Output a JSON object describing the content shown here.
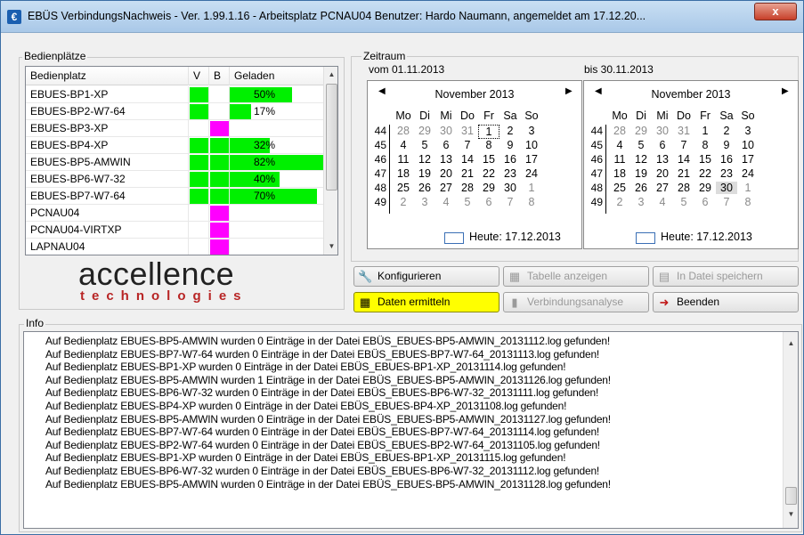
{
  "window": {
    "title": "EBÜS VerbindungsNachweis - Ver. 1.99.1.16 - Arbeitsplatz PCNAU04   Benutzer: Hardo Naumann, angemeldet am 17.12.20...",
    "close_label": "x"
  },
  "bedienplaetze": {
    "group_title": "Bedienplätze",
    "columns": [
      "Bedienplatz",
      "V",
      "B",
      "Geladen"
    ],
    "rows": [
      {
        "name": "EBUES-BP1-XP",
        "v_color": "#00f000",
        "b_color": "#ffffff",
        "geladen": 0.5,
        "geladen_text": "50%"
      },
      {
        "name": "EBUES-BP2-W7-64",
        "v_color": "#00f000",
        "b_color": "#ffffff",
        "geladen": 0.17,
        "geladen_text": "17%"
      },
      {
        "name": "EBUES-BP3-XP",
        "v_color": "#ffffff",
        "b_color": "#ff00ff",
        "geladen": 0,
        "geladen_text": ""
      },
      {
        "name": "EBUES-BP4-XP",
        "v_color": "#00f000",
        "b_color": "#00f000",
        "geladen": 0.32,
        "geladen_text": "32%"
      },
      {
        "name": "EBUES-BP5-AMWIN",
        "v_color": "#00f000",
        "b_color": "#00f000",
        "geladen": 0.82,
        "geladen_text": "82%"
      },
      {
        "name": "EBUES-BP6-W7-32",
        "v_color": "#00f000",
        "b_color": "#00f000",
        "geladen": 0.4,
        "geladen_text": "40%"
      },
      {
        "name": "EBUES-BP7-W7-64",
        "v_color": "#00f000",
        "b_color": "#00f000",
        "geladen": 0.7,
        "geladen_text": "70%"
      },
      {
        "name": "PCNAU04",
        "v_color": "#ffffff",
        "b_color": "#ff00ff",
        "geladen": 0,
        "geladen_text": ""
      },
      {
        "name": "PCNAU04-VIRTXP",
        "v_color": "#ffffff",
        "b_color": "#ff00ff",
        "geladen": 0,
        "geladen_text": ""
      },
      {
        "name": "LAPNAU04",
        "v_color": "#ffffff",
        "b_color": "#ff00ff",
        "geladen": 0,
        "geladen_text": ""
      }
    ]
  },
  "logo": {
    "main": "accellence",
    "sub": "technologies"
  },
  "zeitraum": {
    "group_title": "Zeitraum",
    "von_label": "vom 01.11.2013",
    "bis_label": "bis 30.11.2013",
    "calendars": [
      {
        "month": "November 2013",
        "dow": [
          "Mo",
          "Di",
          "Mi",
          "Do",
          "Fr",
          "Sa",
          "So"
        ],
        "weeks": [
          {
            "wk": "44",
            "days": [
              "28",
              "29",
              "30",
              "31",
              "1",
              "2",
              "3"
            ]
          },
          {
            "wk": "45",
            "days": [
              "4",
              "5",
              "6",
              "7",
              "8",
              "9",
              "10"
            ]
          },
          {
            "wk": "46",
            "days": [
              "11",
              "12",
              "13",
              "14",
              "15",
              "16",
              "17"
            ]
          },
          {
            "wk": "47",
            "days": [
              "18",
              "19",
              "20",
              "21",
              "22",
              "23",
              "24"
            ]
          },
          {
            "wk": "48",
            "days": [
              "25",
              "26",
              "27",
              "28",
              "29",
              "30",
              "1"
            ]
          },
          {
            "wk": "49",
            "days": [
              "2",
              "3",
              "4",
              "5",
              "6",
              "7",
              "8"
            ]
          }
        ],
        "selected_day": "1",
        "today_label": "Heute: 17.12.2013"
      },
      {
        "month": "November 2013",
        "dow": [
          "Mo",
          "Di",
          "Mi",
          "Do",
          "Fr",
          "Sa",
          "So"
        ],
        "weeks": [
          {
            "wk": "44",
            "days": [
              "28",
              "29",
              "30",
              "31",
              "1",
              "2",
              "3"
            ]
          },
          {
            "wk": "45",
            "days": [
              "4",
              "5",
              "6",
              "7",
              "8",
              "9",
              "10"
            ]
          },
          {
            "wk": "46",
            "days": [
              "11",
              "12",
              "13",
              "14",
              "15",
              "16",
              "17"
            ]
          },
          {
            "wk": "47",
            "days": [
              "18",
              "19",
              "20",
              "21",
              "22",
              "23",
              "24"
            ]
          },
          {
            "wk": "48",
            "days": [
              "25",
              "26",
              "27",
              "28",
              "29",
              "30",
              "1"
            ]
          },
          {
            "wk": "49",
            "days": [
              "2",
              "3",
              "4",
              "5",
              "6",
              "7",
              "8"
            ]
          }
        ],
        "selected_day": "30",
        "today_label": "Heute: 17.12.2013"
      }
    ]
  },
  "buttons": {
    "konfigurieren": "Konfigurieren",
    "tabelle": "Tabelle anzeigen",
    "speichern": "In Datei speichern",
    "daten": "Daten ermitteln",
    "analyse": "Verbindungsanalyse",
    "beenden": "Beenden"
  },
  "info": {
    "group_title": "Info",
    "lines": [
      "Auf Bedienplatz EBUES-BP5-AMWIN wurden 0 Einträge in der Datei EBÜS_EBUES-BP5-AMWIN_20131112.log gefunden!",
      "Auf Bedienplatz EBUES-BP7-W7-64 wurden 0 Einträge in der Datei EBÜS_EBUES-BP7-W7-64_20131113.log gefunden!",
      "Auf Bedienplatz EBUES-BP1-XP wurden 0 Einträge in der Datei EBÜS_EBUES-BP1-XP_20131114.log gefunden!",
      "Auf Bedienplatz EBUES-BP5-AMWIN wurden 1 Einträge in der Datei EBÜS_EBUES-BP5-AMWIN_20131126.log gefunden!",
      "Auf Bedienplatz EBUES-BP6-W7-32 wurden 0 Einträge in der Datei EBÜS_EBUES-BP6-W7-32_20131111.log gefunden!",
      "Auf Bedienplatz EBUES-BP4-XP wurden 0 Einträge in der Datei EBÜS_EBUES-BP4-XP_20131108.log gefunden!",
      "Auf Bedienplatz EBUES-BP5-AMWIN wurden 0 Einträge in der Datei EBÜS_EBUES-BP5-AMWIN_20131127.log gefunden!",
      "Auf Bedienplatz EBUES-BP7-W7-64 wurden 0 Einträge in der Datei EBÜS_EBUES-BP7-W7-64_20131114.log gefunden!",
      "Auf Bedienplatz EBUES-BP2-W7-64 wurden 0 Einträge in der Datei EBÜS_EBUES-BP2-W7-64_20131105.log gefunden!",
      "Auf Bedienplatz EBUES-BP1-XP wurden 0 Einträge in der Datei EBÜS_EBUES-BP1-XP_20131115.log gefunden!",
      "Auf Bedienplatz EBUES-BP6-W7-32 wurden 0 Einträge in der Datei EBÜS_EBUES-BP6-W7-32_20131112.log gefunden!",
      "Auf Bedienplatz EBUES-BP5-AMWIN wurden 0 Einträge in der Datei EBÜS_EBUES-BP5-AMWIN_20131128.log gefunden!"
    ]
  }
}
